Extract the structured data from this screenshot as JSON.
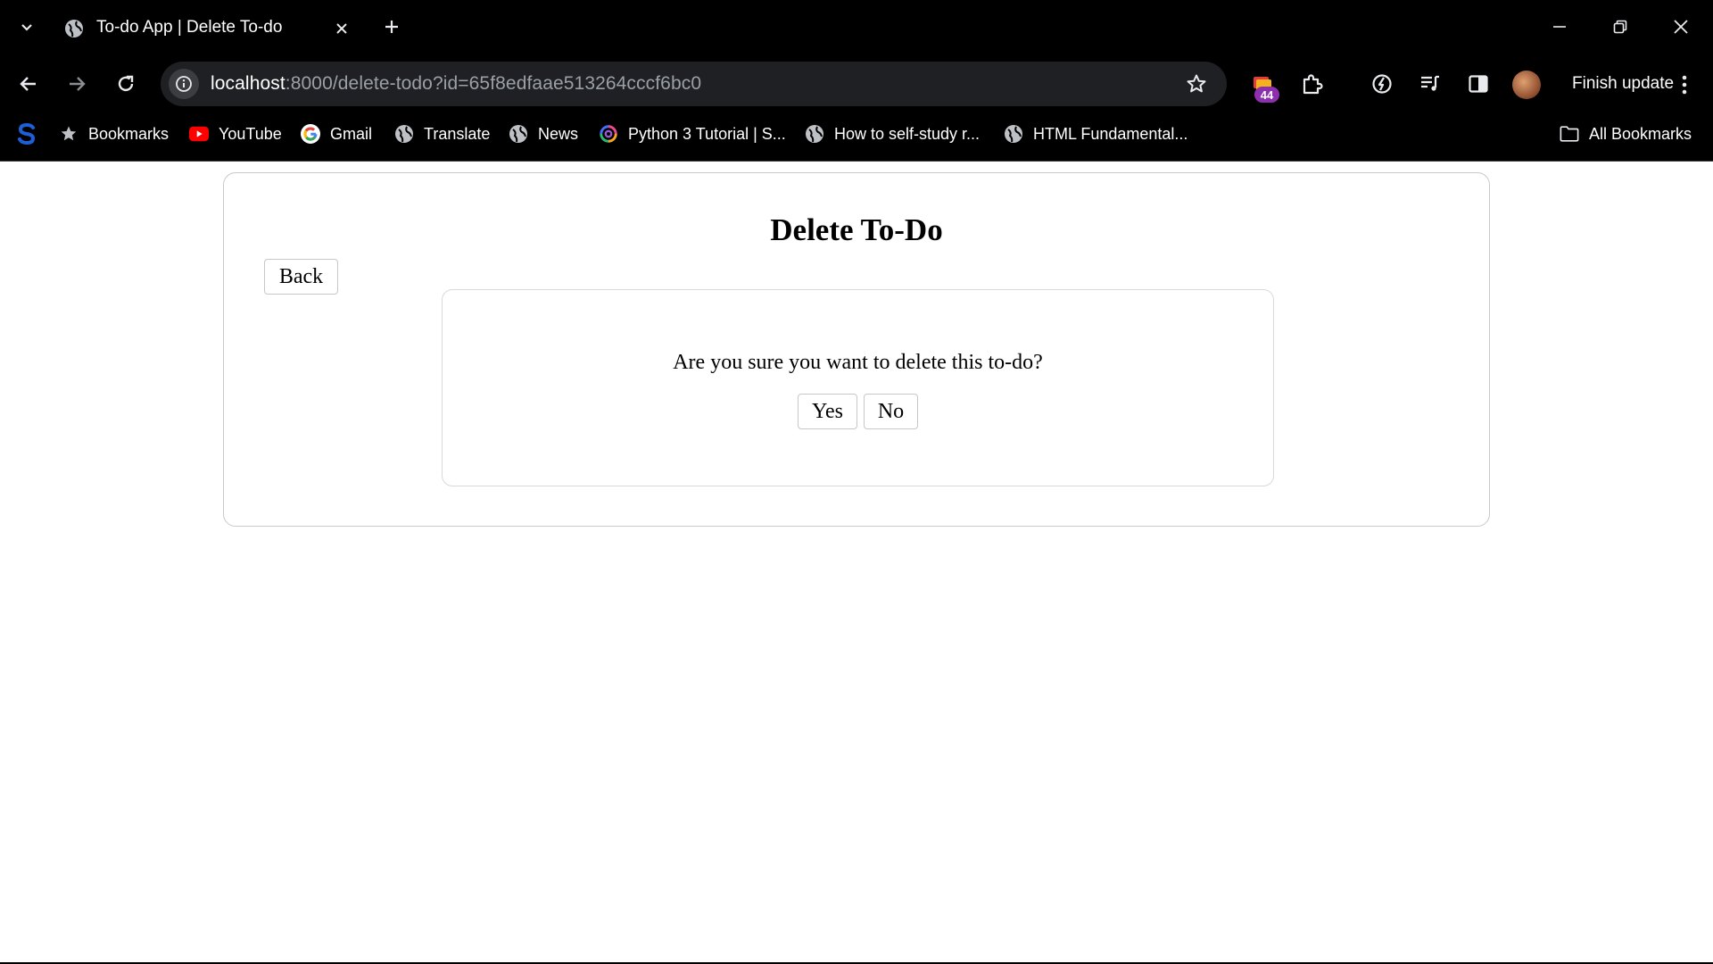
{
  "browser": {
    "tab": {
      "title": "To-do App | Delete To-do",
      "favicon": "globe-icon"
    },
    "address_bar": {
      "url_host": "localhost",
      "url_rest": ":8000/delete-todo?id=65f8edfaae513264cccf6bc0"
    },
    "extensions": {
      "badge_count": "44"
    },
    "finish_update_label": "Finish update",
    "bookmarks": [
      {
        "label": "Bookmarks",
        "icon": "star-icon"
      },
      {
        "label": "YouTube",
        "icon": "youtube-icon"
      },
      {
        "label": "Gmail",
        "icon": "google-icon"
      },
      {
        "label": "Translate",
        "icon": "globe-icon"
      },
      {
        "label": "News",
        "icon": "globe-icon"
      },
      {
        "label": "Python 3 Tutorial | S...",
        "icon": "swirl-icon"
      },
      {
        "label": "How to self-study r...",
        "icon": "globe-icon"
      },
      {
        "label": "HTML Fundamental...",
        "icon": "globe-icon"
      }
    ],
    "all_bookmarks_label": "All Bookmarks",
    "colors": {
      "chrome_bg": "#000000",
      "omnibox_bg": "#1f2023",
      "badge": "#8e2fb0",
      "youtube_red": "#ff0000",
      "brand_s": "#1f5fd6"
    }
  },
  "page": {
    "title": "Delete To-Do",
    "back_label": "Back",
    "confirm_text": "Are you sure you want to delete this to-do?",
    "yes_label": "Yes",
    "no_label": "No"
  }
}
